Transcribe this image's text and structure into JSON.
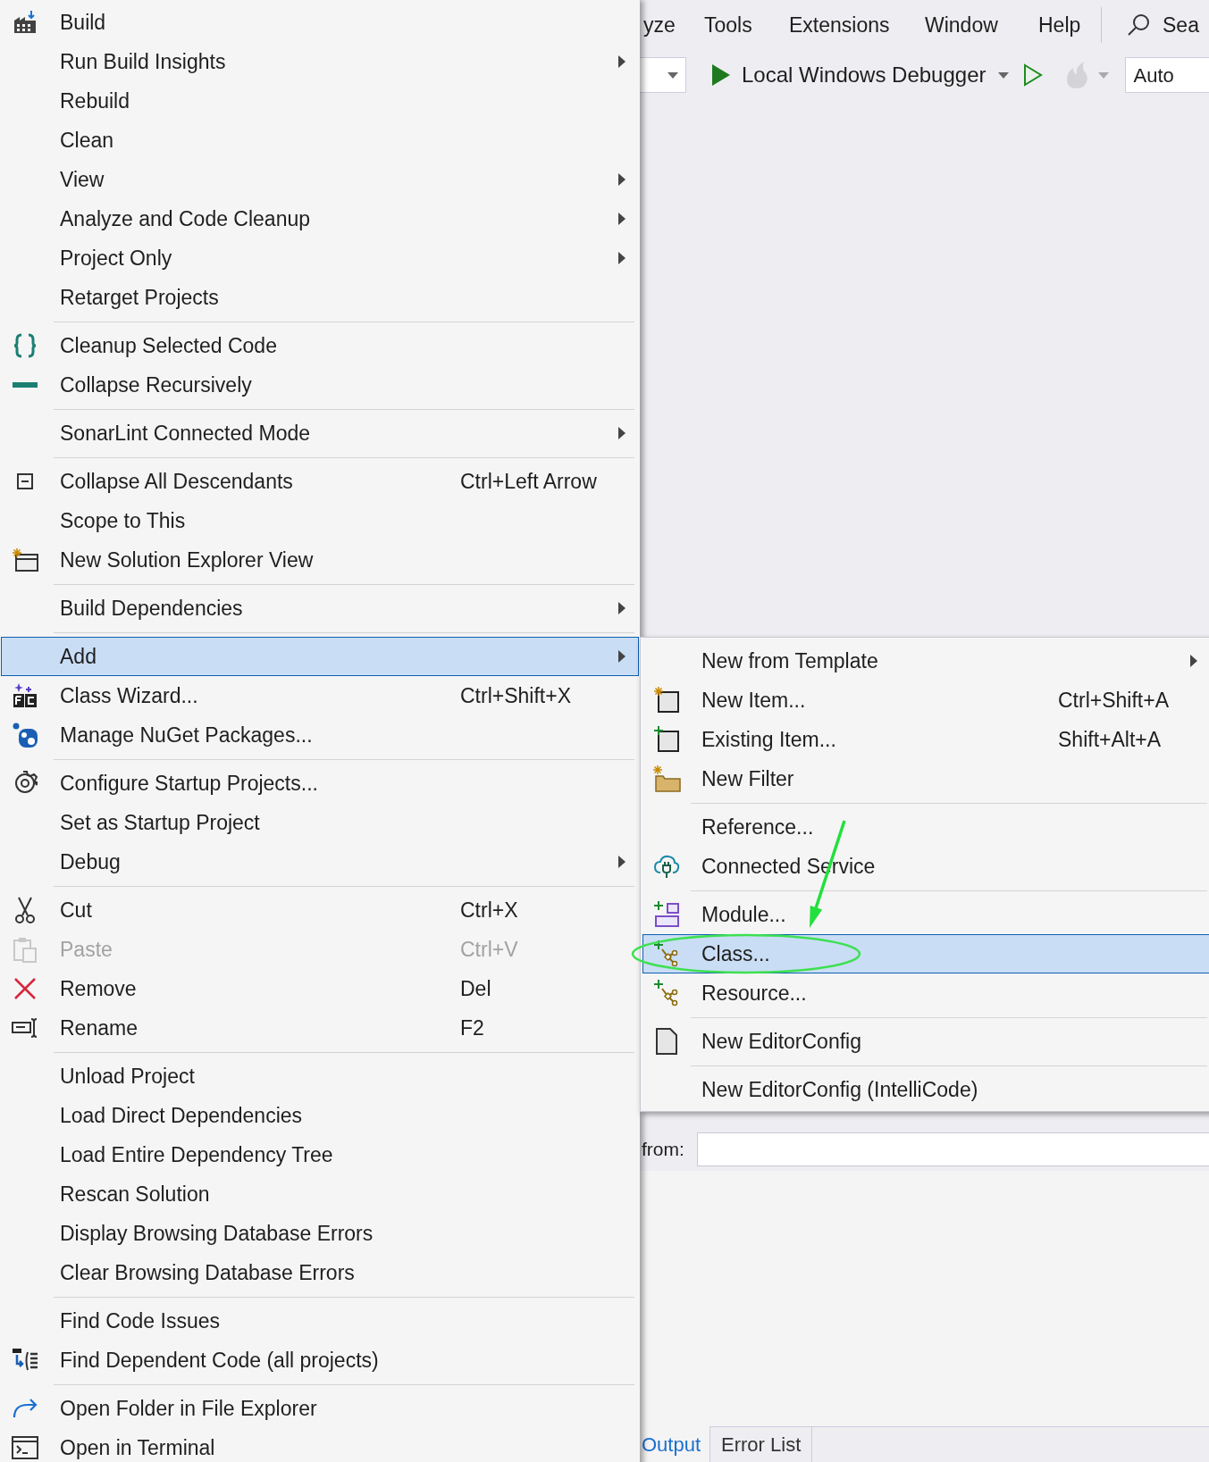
{
  "menu_bar": {
    "items": [
      "yze",
      "Tools",
      "Extensions",
      "Window",
      "Help"
    ],
    "search": "Sea"
  },
  "toolbar": {
    "debugger": "Local Windows Debugger",
    "configuration": "Auto"
  },
  "context_menu": {
    "groups": [
      [
        {
          "label": "Build",
          "submenu": false,
          "selected": false,
          "disabled": false
        },
        {
          "label": "Run Build Insights",
          "submenu": true,
          "selected": false,
          "disabled": false
        },
        {
          "label": "Rebuild",
          "submenu": false,
          "selected": false,
          "disabled": false
        },
        {
          "label": "Clean",
          "submenu": false,
          "selected": false,
          "disabled": false
        },
        {
          "label": "View",
          "submenu": true,
          "selected": false,
          "disabled": false
        },
        {
          "label": "Analyze and Code Cleanup",
          "submenu": true,
          "selected": false,
          "disabled": false
        },
        {
          "label": "Project Only",
          "submenu": true,
          "selected": false,
          "disabled": false
        },
        {
          "label": "Retarget Projects",
          "submenu": false,
          "selected": false,
          "disabled": false
        }
      ],
      [
        {
          "label": "Cleanup Selected Code",
          "submenu": false,
          "selected": false,
          "disabled": false
        },
        {
          "label": "Collapse Recursively",
          "submenu": false,
          "selected": false,
          "disabled": false
        }
      ],
      [
        {
          "label": "SonarLint Connected Mode",
          "submenu": true,
          "selected": false,
          "disabled": false
        }
      ],
      [
        {
          "label": "Collapse All Descendants",
          "shortcut": "Ctrl+Left Arrow",
          "submenu": false,
          "selected": false,
          "disabled": false
        },
        {
          "label": "Scope to This",
          "submenu": false,
          "selected": false,
          "disabled": false
        },
        {
          "label": "New Solution Explorer View",
          "submenu": false,
          "selected": false,
          "disabled": false
        }
      ],
      [
        {
          "label": "Build Dependencies",
          "submenu": true,
          "selected": false,
          "disabled": false
        }
      ],
      [
        {
          "label": "Add",
          "submenu": true,
          "selected": true,
          "disabled": false
        },
        {
          "label": "Class Wizard...",
          "shortcut": "Ctrl+Shift+X",
          "submenu": false,
          "selected": false,
          "disabled": false
        },
        {
          "label": "Manage NuGet Packages...",
          "submenu": false,
          "selected": false,
          "disabled": false
        }
      ],
      [
        {
          "label": "Configure Startup Projects...",
          "submenu": false,
          "selected": false,
          "disabled": false
        },
        {
          "label": "Set as Startup Project",
          "submenu": false,
          "selected": false,
          "disabled": false
        },
        {
          "label": "Debug",
          "submenu": true,
          "selected": false,
          "disabled": false
        }
      ],
      [
        {
          "label": "Cut",
          "shortcut": "Ctrl+X",
          "submenu": false,
          "selected": false,
          "disabled": false
        },
        {
          "label": "Paste",
          "shortcut": "Ctrl+V",
          "submenu": false,
          "selected": false,
          "disabled": true
        },
        {
          "label": "Remove",
          "shortcut": "Del",
          "submenu": false,
          "selected": false,
          "disabled": false
        },
        {
          "label": "Rename",
          "shortcut": "F2",
          "submenu": false,
          "selected": false,
          "disabled": false
        }
      ],
      [
        {
          "label": "Unload Project",
          "submenu": false,
          "selected": false,
          "disabled": false
        },
        {
          "label": "Load Direct Dependencies",
          "submenu": false,
          "selected": false,
          "disabled": false
        },
        {
          "label": "Load Entire Dependency Tree",
          "submenu": false,
          "selected": false,
          "disabled": false
        },
        {
          "label": "Rescan Solution",
          "submenu": false,
          "selected": false,
          "disabled": false
        },
        {
          "label": "Display Browsing Database Errors",
          "submenu": false,
          "selected": false,
          "disabled": false
        },
        {
          "label": "Clear Browsing Database Errors",
          "submenu": false,
          "selected": false,
          "disabled": false
        }
      ],
      [
        {
          "label": "Find Code Issues",
          "submenu": false,
          "selected": false,
          "disabled": false
        },
        {
          "label": "Find Dependent Code (all projects)",
          "submenu": false,
          "selected": false,
          "disabled": false
        }
      ],
      [
        {
          "label": "Open Folder in File Explorer",
          "submenu": false,
          "selected": false,
          "disabled": false
        },
        {
          "label": "Open in Terminal",
          "submenu": false,
          "selected": false,
          "disabled": false
        }
      ]
    ]
  },
  "add_submenu": {
    "groups": [
      [
        {
          "label": "New from Template",
          "submenu": true,
          "selected": false,
          "disabled": false
        },
        {
          "label": "New Item...",
          "shortcut": "Ctrl+Shift+A",
          "submenu": false,
          "selected": false,
          "disabled": false
        },
        {
          "label": "Existing Item...",
          "shortcut": "Shift+Alt+A",
          "submenu": false,
          "selected": false,
          "disabled": false
        },
        {
          "label": "New Filter",
          "submenu": false,
          "selected": false,
          "disabled": false
        }
      ],
      [
        {
          "label": "Reference...",
          "submenu": false,
          "selected": false,
          "disabled": false
        },
        {
          "label": "Connected Service",
          "submenu": false,
          "selected": false,
          "disabled": false
        }
      ],
      [
        {
          "label": "Module...",
          "submenu": false,
          "selected": false,
          "disabled": false
        },
        {
          "label": "Class...",
          "submenu": false,
          "selected": true,
          "disabled": false
        },
        {
          "label": "Resource...",
          "submenu": false,
          "selected": false,
          "disabled": false
        }
      ],
      [
        {
          "label": "New EditorConfig",
          "submenu": false,
          "selected": false,
          "disabled": false
        }
      ],
      [
        {
          "label": "New EditorConfig (IntelliCode)",
          "submenu": false,
          "selected": false,
          "disabled": false
        }
      ]
    ]
  },
  "find_bar": {
    "label": "from:"
  },
  "bottom_tabs": [
    {
      "label": "Output",
      "selected": true
    },
    {
      "label": "Error List",
      "selected": false
    }
  ]
}
